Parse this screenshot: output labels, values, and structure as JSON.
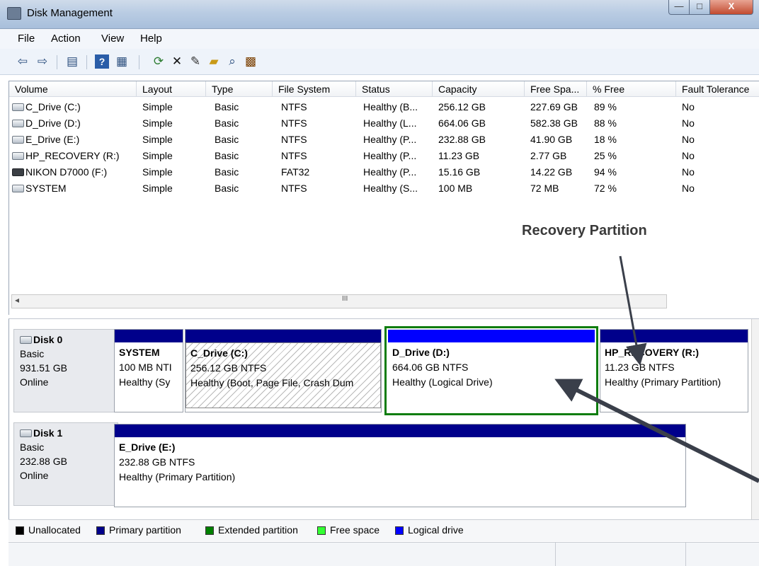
{
  "window": {
    "title": "Disk Management",
    "buttons": {
      "minimize": "—",
      "maximize": "□",
      "close": "X"
    }
  },
  "menu": [
    "File",
    "Action",
    "View",
    "Help"
  ],
  "toolbar_icons": [
    "back-icon",
    "forward-icon",
    "properties-view-icon",
    "help-icon",
    "list-view-icon",
    "refresh-icon",
    "delete-icon",
    "properties-icon",
    "open-icon",
    "search-icon",
    "wizard-icon"
  ],
  "volume_table": {
    "columns": [
      "Volume",
      "Layout",
      "Type",
      "File System",
      "Status",
      "Capacity",
      "Free Spa...",
      "% Free",
      "Fault Tolerance"
    ],
    "rows": [
      {
        "volume": "C_Drive (C:)",
        "layout": "Simple",
        "type": "Basic",
        "fs": "NTFS",
        "status": "Healthy (B...",
        "capacity": "256.12 GB",
        "free": "227.69 GB",
        "pct": "89 %",
        "fault": "No",
        "icon": "drive-icon"
      },
      {
        "volume": "D_Drive (D:)",
        "layout": "Simple",
        "type": "Basic",
        "fs": "NTFS",
        "status": "Healthy (L...",
        "capacity": "664.06 GB",
        "free": "582.38 GB",
        "pct": "88 %",
        "fault": "No",
        "icon": "drive-icon"
      },
      {
        "volume": "E_Drive (E:)",
        "layout": "Simple",
        "type": "Basic",
        "fs": "NTFS",
        "status": "Healthy (P...",
        "capacity": "232.88 GB",
        "free": "41.90 GB",
        "pct": "18 %",
        "fault": "No",
        "icon": "drive-icon"
      },
      {
        "volume": "HP_RECOVERY (R:)",
        "layout": "Simple",
        "type": "Basic",
        "fs": "NTFS",
        "status": "Healthy (P...",
        "capacity": "11.23 GB",
        "free": "2.77 GB",
        "pct": "25 %",
        "fault": "No",
        "icon": "drive-icon"
      },
      {
        "volume": "NIKON D7000 (F:)",
        "layout": "Simple",
        "type": "Basic",
        "fs": "FAT32",
        "status": "Healthy (P...",
        "capacity": "15.16 GB",
        "free": "14.22 GB",
        "pct": "94 %",
        "fault": "No",
        "icon": "removable-drive-icon"
      },
      {
        "volume": "SYSTEM",
        "layout": "Simple",
        "type": "Basic",
        "fs": "NTFS",
        "status": "Healthy (S...",
        "capacity": "100 MB",
        "free": "72 MB",
        "pct": "72 %",
        "fault": "No",
        "icon": "drive-icon"
      }
    ],
    "scroll_grip": "III"
  },
  "annotation": "Recovery Partition",
  "disks": [
    {
      "name": "Disk 0",
      "type": "Basic",
      "size": "931.51 GB",
      "state": "Online",
      "partitions": [
        {
          "name": "SYSTEM",
          "size": "100 MB NTI",
          "status": "Healthy (Sy"
        },
        {
          "name": "C_Drive  (C:)",
          "size": "256.12 GB NTFS",
          "status": "Healthy (Boot, Page File, Crash Dum"
        },
        {
          "name": "D_Drive  (D:)",
          "size": "664.06 GB NTFS",
          "status": "Healthy (Logical Drive)"
        },
        {
          "name": "HP_RECOVERY  (R:)",
          "size": "11.23 GB NTFS",
          "status": "Healthy (Primary Partition)"
        }
      ]
    },
    {
      "name": "Disk 1",
      "type": "Basic",
      "size": "232.88 GB",
      "state": "Online",
      "partitions": [
        {
          "name": "E_Drive  (E:)",
          "size": "232.88 GB NTFS",
          "status": "Healthy (Primary Partition)"
        }
      ]
    }
  ],
  "legend": [
    {
      "label": "Unallocated",
      "color": "#000000"
    },
    {
      "label": "Primary partition",
      "color": "#00008b"
    },
    {
      "label": "Extended partition",
      "color": "#008000"
    },
    {
      "label": "Free space",
      "color": "#33ff33"
    },
    {
      "label": "Logical drive",
      "color": "#0000ff"
    }
  ]
}
